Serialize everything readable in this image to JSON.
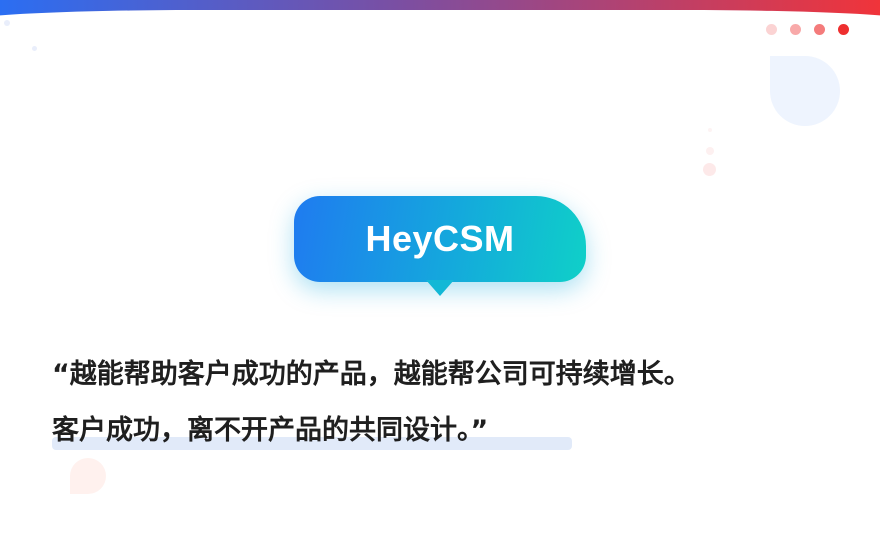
{
  "brand": {
    "name": "HeyCSM"
  },
  "quote": {
    "line1": "“越能帮助客户成功的产品，越能帮公司可持续增长。",
    "line2": "客户成功，离不开产品的共同设计。”"
  },
  "colors": {
    "bubble_start": "#1f7bf0",
    "bubble_end": "#0fd0c8",
    "dots": [
      "#fbd3d3",
      "#f8a9a9",
      "#f47b7b",
      "#ee2f2f"
    ]
  },
  "icons": [
    "speech-bubble-icon"
  ]
}
